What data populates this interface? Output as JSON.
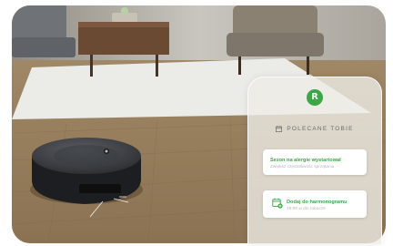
{
  "panel": {
    "logo_letter": "R",
    "section_title": "POLECANE TOBIE",
    "cards": [
      {
        "title": "Sezon na alergie wystartował",
        "subtitle": "Zwiększ częstotliwość sprzątania"
      },
      {
        "title": "Dodaj do harmonogramu",
        "subtitle": "19:00 w dni robocze"
      }
    ]
  },
  "icons": {
    "logo": "irobot-logo-icon",
    "section": "calendar-icon",
    "card_2": "calendar-add-icon"
  },
  "colors": {
    "accent_green": "#3aa845",
    "panel_text": "#6b6b6b",
    "muted_text": "#b5b5b5"
  }
}
